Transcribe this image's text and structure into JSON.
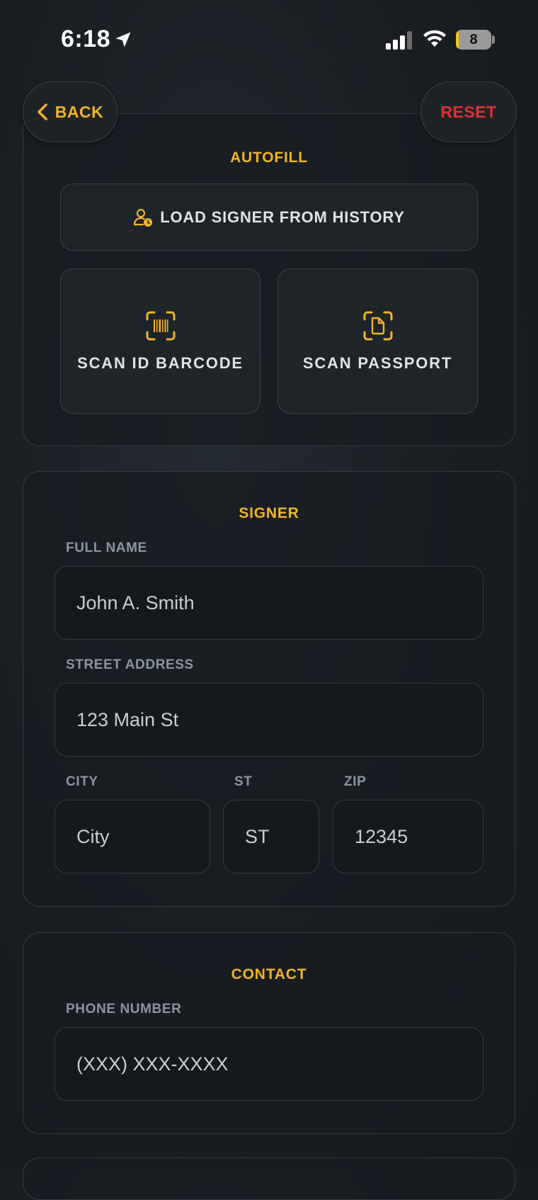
{
  "status_bar": {
    "time": "6:18",
    "battery_level": "8"
  },
  "nav": {
    "back_label": "BACK",
    "reset_label": "RESET"
  },
  "autofill": {
    "title": "AUTOFILL",
    "load_history_label": "LOAD SIGNER FROM HISTORY",
    "scan_barcode_label": "SCAN ID BARCODE",
    "scan_passport_label": "SCAN PASSPORT"
  },
  "signer": {
    "title": "SIGNER",
    "full_name_label": "FULL NAME",
    "full_name_placeholder": "John A. Smith",
    "street_label": "STREET ADDRESS",
    "street_placeholder": "123 Main St",
    "city_label": "CITY",
    "city_placeholder": "City",
    "state_label": "ST",
    "state_placeholder": "ST",
    "zip_label": "ZIP",
    "zip_placeholder": "12345"
  },
  "contact": {
    "title": "CONTACT",
    "phone_label": "PHONE NUMBER",
    "phone_placeholder": "(XXX) XXX-XXXX"
  },
  "colors": {
    "accent": "#f0b429",
    "danger": "#e0312f",
    "label": "#8b95a1",
    "background": "#1a1e23"
  },
  "icons": [
    "location-arrow-icon",
    "cellular-signal-icon",
    "wifi-icon",
    "battery-icon",
    "chevron-left-icon",
    "person-clock-icon",
    "barcode-scan-icon",
    "document-scan-icon"
  ]
}
